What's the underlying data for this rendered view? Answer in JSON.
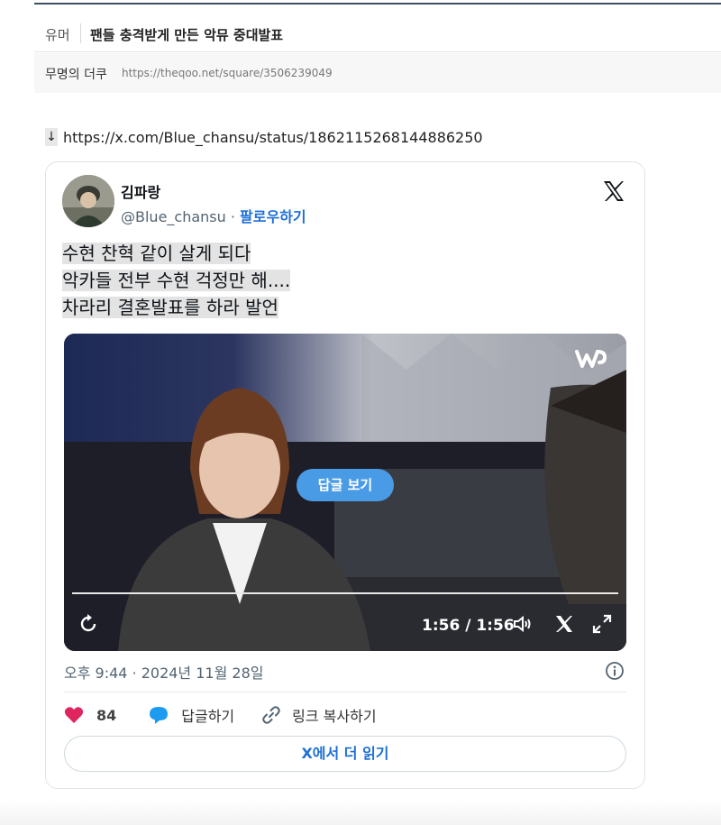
{
  "post": {
    "category": "유머",
    "title": "팬들 충격받게 만든 악뮤 중대발표",
    "author": "무명의 더쿠",
    "permalink": "https://theqoo.net/square/3506239049"
  },
  "source": {
    "arrow": "↓",
    "url": "https://x.com/Blue_chansu/status/1862115268144886250"
  },
  "tweet": {
    "display_name": "김파랑",
    "handle": "@Blue_chansu",
    "dot": "·",
    "follow_label": "팔로우하기",
    "lines": [
      "수현 찬혁 같이 살게 되다",
      "악카들 전부 수현 걱정만 해....",
      "차라리 결혼발표를 하라 발언"
    ],
    "video": {
      "replies_button": "답글 보기",
      "time": "1:56 / 1:56",
      "progress": 1.0,
      "watermark_icon": "weverse-icon"
    },
    "datetime": "오후 9:44 · 2024년 11월 28일",
    "likes": "84",
    "reply_label": "답글하기",
    "copy_link_label": "링크 복사하기",
    "read_more_label": "X에서 더 읽기"
  },
  "colors": {
    "accent": "#1d6fd6",
    "heart": "#e0245e",
    "reply_bubble": "#1d9bf0",
    "replies_button": "#4a9be6"
  }
}
